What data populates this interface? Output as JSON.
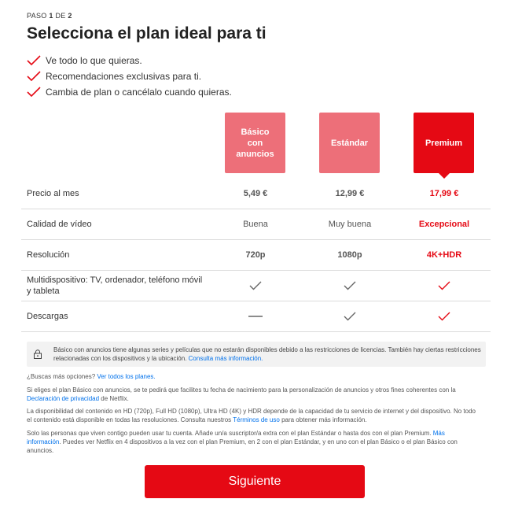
{
  "step": {
    "prefix": "PASO ",
    "current": "1",
    "middle": " DE ",
    "total": "2"
  },
  "title": "Selecciona el plan ideal para ti",
  "benefits": [
    "Ve todo lo que quieras.",
    "Recomendaciones exclusivas para ti.",
    "Cambia de plan o cancélalo cuando quieras."
  ],
  "plans": [
    {
      "name_lines": [
        "Básico",
        "con",
        "anuncios"
      ],
      "selected": false
    },
    {
      "name_lines": [
        "Estándar"
      ],
      "selected": false
    },
    {
      "name_lines": [
        "Premium"
      ],
      "selected": true
    }
  ],
  "rows": {
    "price": {
      "label": "Precio al mes",
      "values": [
        "5,49 €",
        "12,99 €",
        "17,99 €"
      ]
    },
    "quality": {
      "label": "Calidad de vídeo",
      "values": [
        "Buena",
        "Muy buena",
        "Excepcional"
      ]
    },
    "resolution": {
      "label": "Resolución",
      "values": [
        "720p",
        "1080p",
        "4K+HDR"
      ]
    },
    "devices": {
      "label": "Multidispositivo: TV, ordenador, teléfono móvil y tableta",
      "values": [
        "check-icon",
        "check-icon",
        "check-icon"
      ]
    },
    "downloads": {
      "label": "Descargas",
      "values": [
        "dash-icon",
        "check-icon",
        "check-icon"
      ]
    }
  },
  "notice": {
    "text": "Básico con anuncios tiene algunas series y películas que no estarán disponibles debido a las restricciones de licencias. También hay ciertas restricciones relacionadas con los dispositivos y la ubicación. ",
    "link": "Consulta más información."
  },
  "more_options": {
    "text": "¿Buscas más opciones? ",
    "link": "Ver todos los planes."
  },
  "basic_ads_note": {
    "text": "Si eliges el plan Básico con anuncios, se te pedirá que facilites tu fecha de nacimiento para la personalización de anuncios y otros fines coherentes con la ",
    "link": "Declaración de privacidad",
    "after": " de Netflix."
  },
  "availability_note": {
    "text": "La disponibilidad del contenido en HD (720p), Full HD (1080p), Ultra HD (4K) y HDR depende de la capacidad de tu servicio de internet y del dispositivo. No todo el contenido está disponible en todas las resoluciones. Consulta nuestros ",
    "link": "Términos de uso",
    "after": " para obtener más información."
  },
  "household_note": {
    "text": "Solo las personas que viven contigo pueden usar tu cuenta. Añade un/a suscriptor/a extra con el plan Estándar o hasta dos con el plan Premium. ",
    "link": "Más información",
    "after": ". Puedes ver Netflix en 4 dispositivos a la vez con el plan Premium, en 2 con el plan Estándar, y en uno con el plan Básico o el plan Básico con anuncios."
  },
  "next_button": "Siguiente",
  "colors": {
    "brand": "#e50914",
    "muted_plan": "#ed6f79",
    "link": "#0071eb"
  }
}
